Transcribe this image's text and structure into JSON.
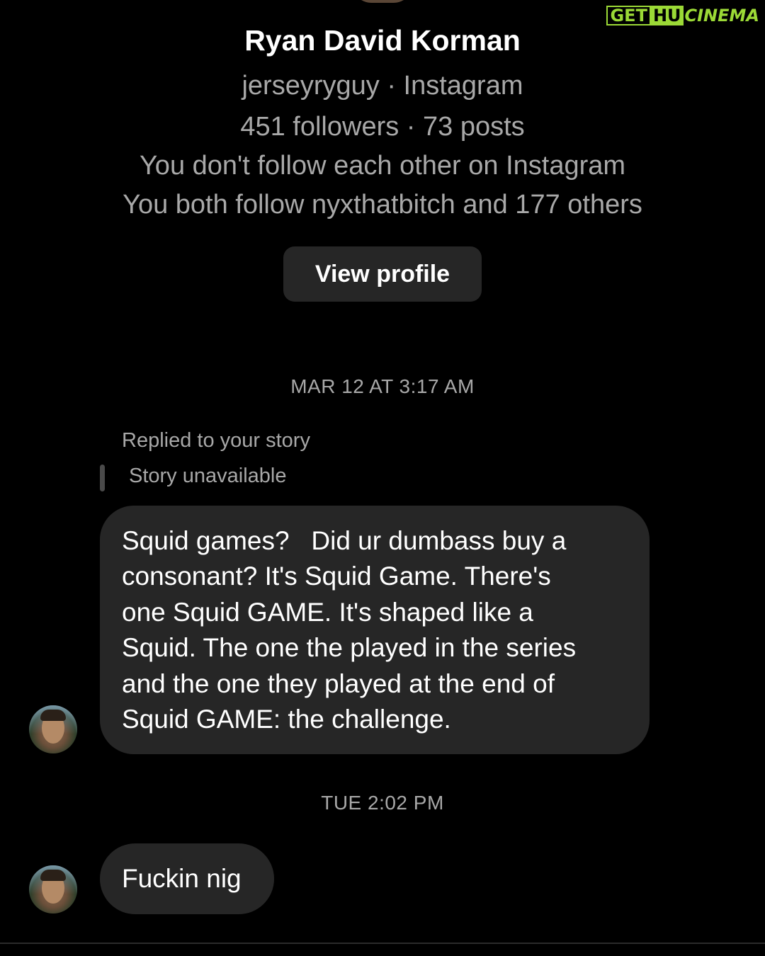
{
  "watermark": {
    "part1": "GET",
    "part2": "HU",
    "part3": "CINEMA"
  },
  "profile": {
    "name": "Ryan David Korman",
    "handle_line": "jerseyryguy · Instagram",
    "stats_line": "451 followers · 73 posts",
    "follow_status": "You don't follow each other on Instagram",
    "mutual_line": "You both follow nyxthatbitch and 177 others",
    "view_profile_label": "View profile"
  },
  "conversation": {
    "timestamp_1": "MAR 12 AT 3:17 AM",
    "replied_label": "Replied to your story",
    "story_status": "Story unavailable",
    "message_1_lines": [
      "Squid games?   Did ur dumbass buy a",
      "consonant? It's Squid Game. There's",
      "one Squid GAME. It's shaped like a",
      "Squid. The one the played in the series",
      "and the one they played at the end of",
      "Squid GAME: the challenge."
    ],
    "timestamp_2": "TUE 2:02 PM",
    "message_2": "Fuckin nig"
  },
  "colors": {
    "background": "#000000",
    "bubble": "#262626",
    "secondary_text": "#a8a8a8",
    "watermark_green": "#9bd936"
  }
}
